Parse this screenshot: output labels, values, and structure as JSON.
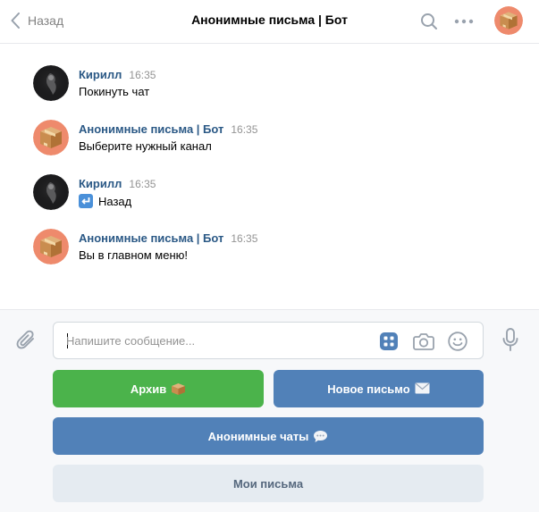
{
  "header": {
    "back_label": "Назад",
    "title": "Анонимные письма | Бот"
  },
  "messages": [
    {
      "author": "Кирилл",
      "time": "16:35",
      "text": "Покинуть чат",
      "avatar": "user-avatar"
    },
    {
      "author": "Анонимные письма | Бот",
      "time": "16:35",
      "text": "Выберите нужный канал",
      "avatar": "bot-avatar"
    },
    {
      "author": "Кирилл",
      "time": "16:35",
      "text": "Назад",
      "text_emoji": "back-arrow-emoji",
      "avatar": "user-avatar"
    },
    {
      "author": "Анонимные письма | Бот",
      "time": "16:35",
      "text": "Вы в главном меню!",
      "avatar": "bot-avatar"
    }
  ],
  "composer": {
    "placeholder": "Напишите сообщение..."
  },
  "keyboard": {
    "archive": {
      "label": "Архив",
      "emoji": "package-emoji",
      "color": "#4bb34b"
    },
    "new_letter": {
      "label": "Новое письмо",
      "emoji": "envelope-emoji",
      "color": "#5181b8"
    },
    "anon_chats": {
      "label": "Анонимные чаты",
      "emoji": "speech-bubble-emoji",
      "color": "#5181b8"
    },
    "my_letters": {
      "label": "Мои письма",
      "color": "#e5ebf1"
    }
  }
}
